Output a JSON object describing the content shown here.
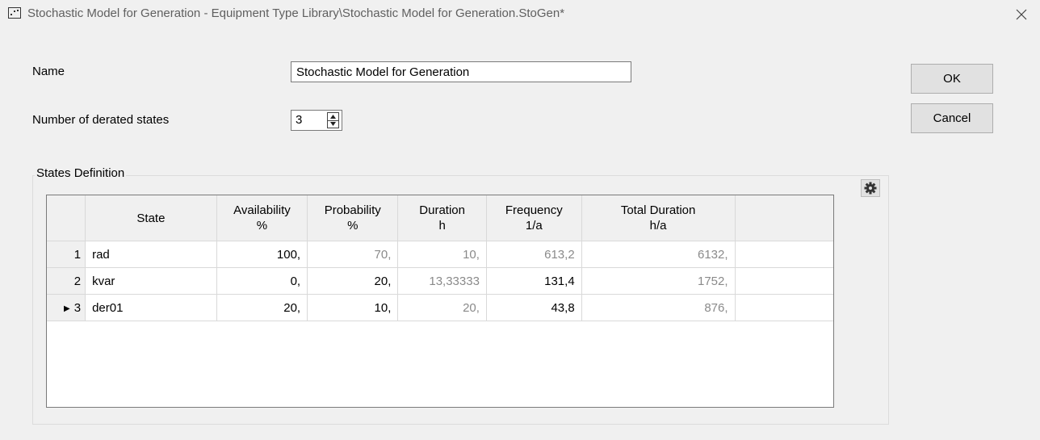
{
  "window": {
    "title": "Stochastic Model for Generation - Equipment Type Library\\Stochastic Model for Generation.StoGen*"
  },
  "form": {
    "name_label": "Name",
    "name_value": "Stochastic Model for Generation",
    "derated_label": "Number of derated states",
    "derated_value": "3"
  },
  "buttons": {
    "ok": "OK",
    "cancel": "Cancel"
  },
  "states_definition": {
    "group_label": "States Definition",
    "columns": [
      {
        "line1": "State",
        "line2": ""
      },
      {
        "line1": "Availability",
        "line2": "%"
      },
      {
        "line1": "Probability",
        "line2": "%"
      },
      {
        "line1": "Duration",
        "line2": "h"
      },
      {
        "line1": "Frequency",
        "line2": "1/a"
      },
      {
        "line1": "Total Duration",
        "line2": "h/a"
      }
    ],
    "rows": [
      {
        "num": "1",
        "state": "rad",
        "availability": "100,",
        "probability": "70,",
        "duration": "10,",
        "frequency": "613,2",
        "total_duration": "6132,"
      },
      {
        "num": "2",
        "state": "kvar",
        "availability": "0,",
        "probability": "20,",
        "duration": "13,33333",
        "frequency": "131,4",
        "total_duration": "1752,"
      },
      {
        "num": "3",
        "state": "der01",
        "availability": "20,",
        "probability": "10,",
        "duration": "20,",
        "frequency": "43,8",
        "total_duration": "876,"
      }
    ],
    "current_row": 3
  },
  "icons": {
    "app": "dialog-icon",
    "close": "close-icon",
    "spin_up": "triangle-up-icon",
    "spin_down": "triangle-down-icon",
    "settings": "gear-icon",
    "row_indicator": "triangle-right-icon"
  }
}
